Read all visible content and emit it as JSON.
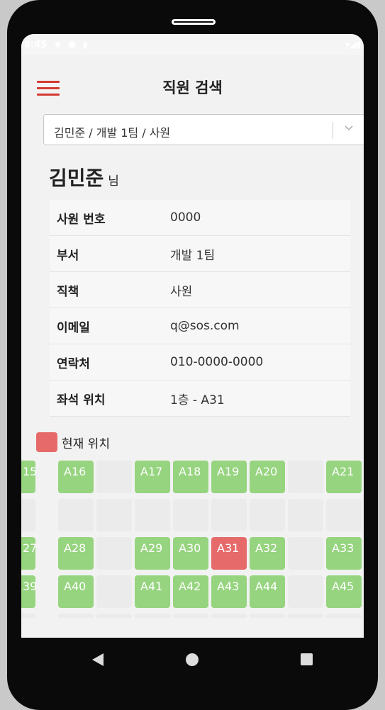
{
  "status": {
    "time": "8:45"
  },
  "header": {
    "title": "직원 검색"
  },
  "employee_select": {
    "value": "김민준 / 개발 1팀 / 사원"
  },
  "employee": {
    "name": "김민준",
    "honorific": "님",
    "fields": [
      {
        "label": "사원 번호",
        "value": "0000"
      },
      {
        "label": "부서",
        "value": "개발 1팀"
      },
      {
        "label": "직책",
        "value": "사원"
      },
      {
        "label": "이메일",
        "value": "q@sos.com"
      },
      {
        "label": "연락처",
        "value": "010-0000-0000"
      },
      {
        "label": "좌석 위치",
        "value": "1층 - A31"
      }
    ]
  },
  "legend": {
    "label": "현재 위치",
    "color": "#e66a6a"
  },
  "seat_colors": {
    "available": "#96d47f",
    "current": "#e66a6a",
    "empty": "#ebebeb"
  },
  "seat_rows": [
    [
      "15",
      "A16",
      "",
      "A17",
      "A18",
      "A19",
      "A20",
      "",
      "A21",
      ""
    ],
    [
      "",
      "",
      "",
      "",
      "",
      "",
      "",
      "",
      "",
      ""
    ],
    [
      "27",
      "A28",
      "",
      "A29",
      "A30",
      "A31",
      "A32",
      "",
      "A33",
      ""
    ],
    [
      "39",
      "A40",
      "",
      "A41",
      "A42",
      "A43",
      "A44",
      "",
      "A45",
      ""
    ],
    [
      "",
      "",
      "",
      "",
      "",
      "",
      "",
      "",
      "",
      ""
    ]
  ],
  "current_seat": "A31",
  "icons": {
    "menu": "hamburger-icon",
    "dropdown": "chevron-down-icon"
  }
}
